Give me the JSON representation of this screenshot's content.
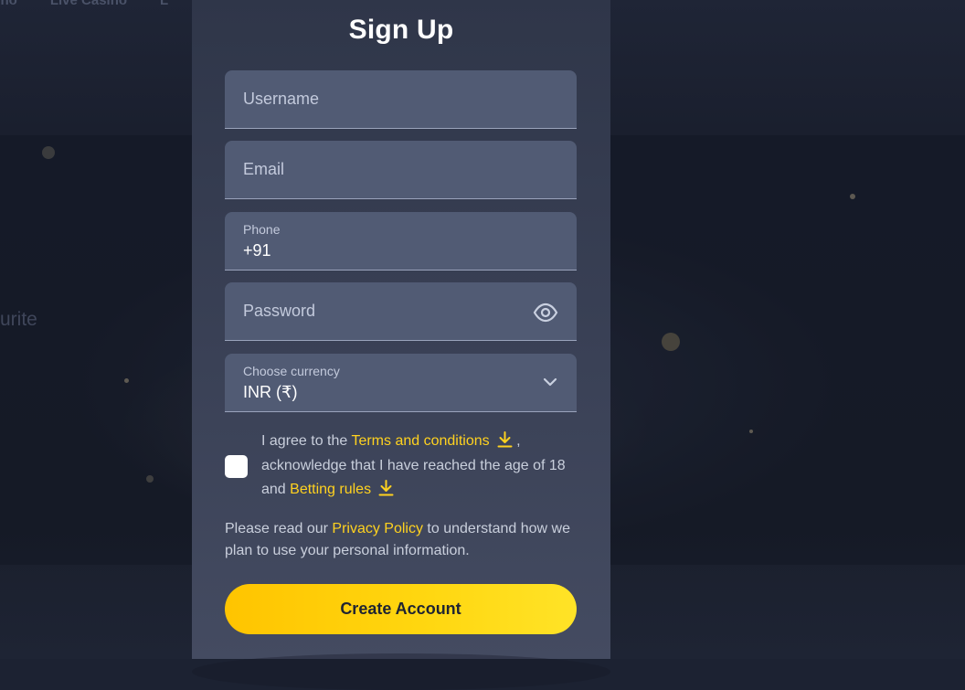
{
  "nav": {
    "items": [
      "sino",
      "Live Casino",
      "L"
    ]
  },
  "background": {
    "partial_word": "urite"
  },
  "form": {
    "title": "Sign Up",
    "username": {
      "placeholder": "Username"
    },
    "email": {
      "placeholder": "Email"
    },
    "phone": {
      "label": "Phone",
      "value": "+91"
    },
    "password": {
      "placeholder": "Password",
      "toggle_icon": "eye-icon"
    },
    "currency": {
      "label": "Choose currency",
      "value": "INR (₹)",
      "icon": "chevron-down-icon"
    },
    "agreement": {
      "text_1": "I agree to the ",
      "terms_link": "Terms and conditions",
      "text_2": " ,",
      "text_3": "acknowledge that I have reached the age of 18 and ",
      "rules_link": "Betting rules",
      "download_icon": "download-icon",
      "checked": false
    },
    "privacy": {
      "text_1": "Please read our ",
      "link": "Privacy Policy",
      "text_2": " to understand how we plan to use your personal information."
    },
    "submit_label": "Create Account"
  },
  "colors": {
    "accent": "#ffd21f",
    "button_gradient_start": "#ffc400",
    "button_gradient_end": "#ffe327",
    "panel_bg": "#3a4156",
    "field_bg": "#515b74"
  }
}
